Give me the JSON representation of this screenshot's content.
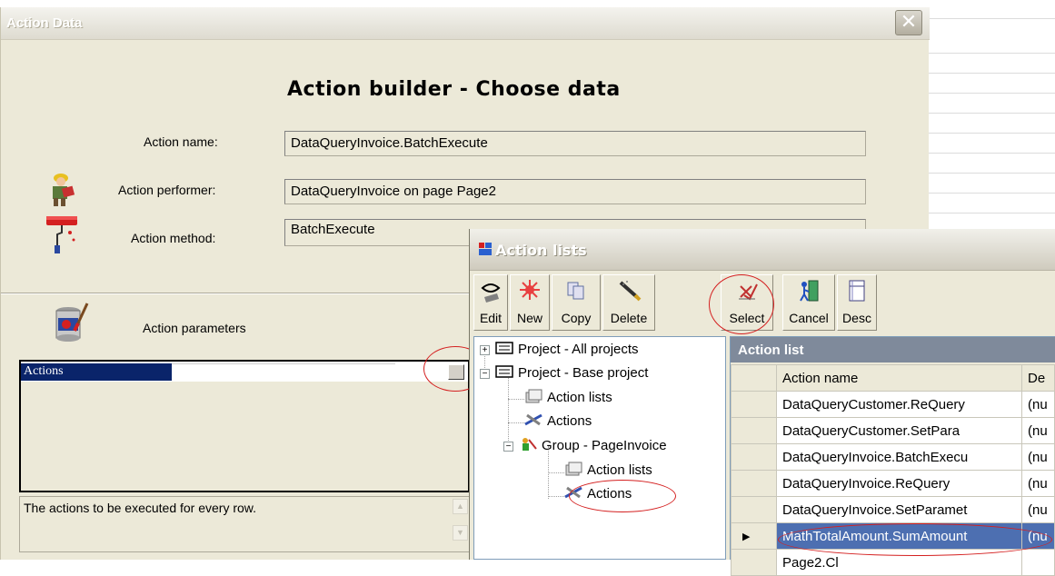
{
  "action_data": {
    "title": "Action Data",
    "close_glyph": "✕",
    "heading": "Action builder - Choose data",
    "action_name_label": "Action name:",
    "action_name_value": "DataQueryInvoice.BatchExecute",
    "action_performer_label": "Action performer:",
    "action_performer_value": "DataQueryInvoice on page Page2",
    "action_method_label": "Action method:",
    "action_method_value": "BatchExecute",
    "action_parameters_label": "Action parameters",
    "grid_selected_row": "Actions",
    "description": "The actions to be executed for every row."
  },
  "action_lists": {
    "title": "Action lists",
    "toolbar": [
      {
        "label": "Edit",
        "icon": "edit-icon"
      },
      {
        "label": "New",
        "icon": "new-icon"
      },
      {
        "label": "Copy",
        "icon": "copy-icon"
      },
      {
        "label": "Delete",
        "icon": "delete-icon"
      },
      {
        "label": "Select",
        "icon": "select-icon"
      },
      {
        "label": "Cancel",
        "icon": "cancel-icon"
      },
      {
        "label": "Desc",
        "icon": "desc-icon"
      }
    ],
    "tree": [
      {
        "label": "Project - All projects",
        "expander": "+"
      },
      {
        "label": "Project - Base project",
        "expander": "−"
      },
      {
        "label": "Action lists"
      },
      {
        "label": "Actions"
      },
      {
        "label": "Group - PageInvoice",
        "expander": "−"
      },
      {
        "label": "Action lists"
      },
      {
        "label": "Actions"
      }
    ],
    "list": {
      "header": "Action list",
      "columns": [
        "Action name",
        "De"
      ],
      "rows": [
        {
          "name": "DataQueryCustomer.ReQuery",
          "de": "(nu"
        },
        {
          "name": "DataQueryCustomer.SetPara",
          "de": "(nu"
        },
        {
          "name": "DataQueryInvoice.BatchExecu",
          "de": "(nu"
        },
        {
          "name": "DataQueryInvoice.ReQuery",
          "de": "(nu"
        },
        {
          "name": "DataQueryInvoice.SetParamet",
          "de": "(nu"
        },
        {
          "name": "MathTotalAmount.SumAmount",
          "de": "(nu",
          "current_marker": "▶"
        },
        {
          "name": "Page2.Cl",
          "de": ""
        }
      ]
    }
  },
  "colors": {
    "selection": "#0a246a",
    "highlight_row": "#4d6fb1",
    "annotation": "#d42020"
  }
}
